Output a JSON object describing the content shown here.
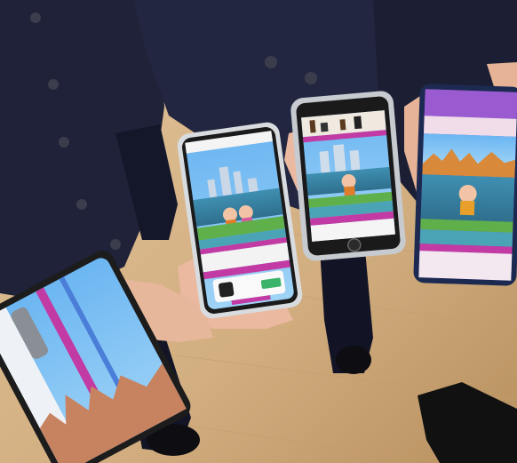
{
  "photo": {
    "subject": "",
    "colors": {
      "floor_light": "#d9b98f",
      "floor_dark": "#b78d5f",
      "uniform": "#1e2138",
      "uniform_shadow": "#121423",
      "skin": "#e9b9a1",
      "phone_sky": "#5fa4ea",
      "phone_magenta": "#c23aa3",
      "phone_teal": "#4aa4b5",
      "phone_green": "#5fb04a",
      "phone_frame": "#1c1c1c"
    }
  }
}
